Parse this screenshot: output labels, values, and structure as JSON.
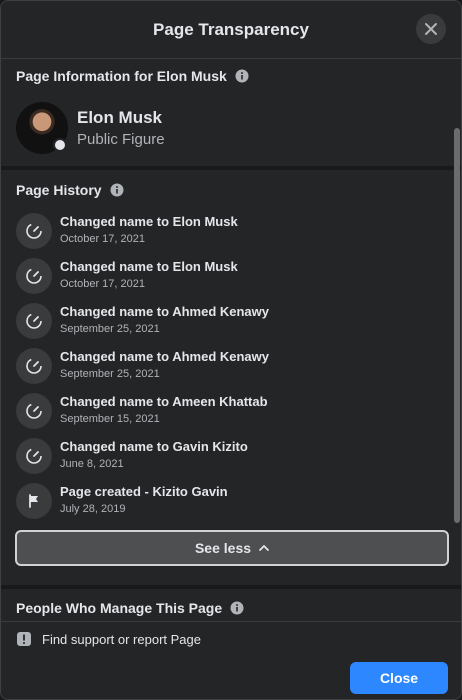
{
  "dialog": {
    "title": "Page Transparency",
    "close_icon": "close-icon"
  },
  "page_info": {
    "heading": "Page Information for Elon Musk",
    "name": "Elon Musk",
    "category": "Public Figure"
  },
  "history": {
    "heading": "Page History",
    "items": [
      {
        "title": "Changed name to Elon Musk",
        "date": "October 17, 2021",
        "icon": "name-change-icon"
      },
      {
        "title": "Changed name to Elon Musk",
        "date": "October 17, 2021",
        "icon": "name-change-icon"
      },
      {
        "title": "Changed name to Ahmed Kenawy",
        "date": "September 25, 2021",
        "icon": "name-change-icon"
      },
      {
        "title": "Changed name to Ahmed Kenawy",
        "date": "September 25, 2021",
        "icon": "name-change-icon"
      },
      {
        "title": "Changed name to Ameen Khattab",
        "date": "September 15, 2021",
        "icon": "name-change-icon"
      },
      {
        "title": "Changed name to Gavin Kizito",
        "date": "June 8, 2021",
        "icon": "name-change-icon"
      },
      {
        "title": "Page created - Kizito Gavin",
        "date": "July 28, 2019",
        "icon": "flag-icon"
      }
    ],
    "see_less_label": "See less"
  },
  "managers": {
    "heading": "People Who Manage This Page"
  },
  "footer": {
    "report_label": "Find support or report Page",
    "close_label": "Close"
  },
  "colors": {
    "background": "#242526",
    "accent": "#2d88ff",
    "text_primary": "#e4e6eb",
    "text_secondary": "#b0b3b8"
  }
}
